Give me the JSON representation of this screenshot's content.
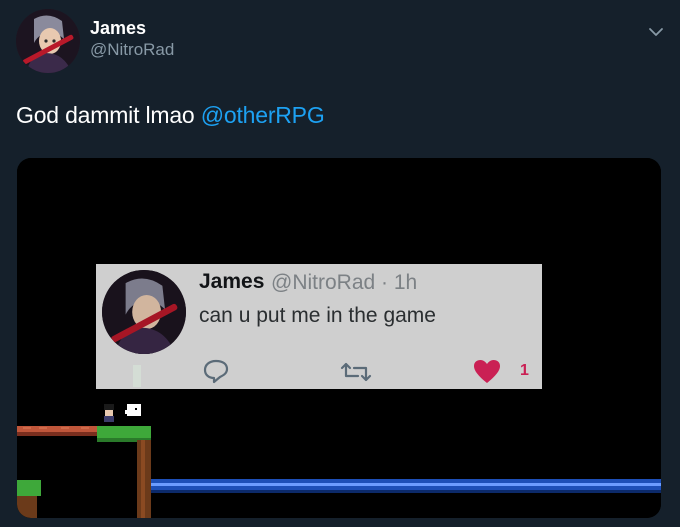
{
  "tweet": {
    "author_name": "James",
    "author_handle": "@NitroRad",
    "text": "God dammit lmao ",
    "mention": "@otherRPG",
    "menu_icon": "chevron-down-icon"
  },
  "media": {
    "description_icon": "game-screenshot",
    "embedded_tweet": {
      "author_name": "James",
      "author_handle": "@NitroRad · 1h",
      "text": "can u put me in the game",
      "reply_icon": "reply-icon",
      "retweet_icon": "retweet-icon",
      "like_icon": "heart-icon",
      "like_count": "1",
      "like_color": "#e0245e"
    }
  },
  "colors": {
    "background": "#15202b",
    "accent": "#1da1f2",
    "secondary_text": "#8899a6"
  }
}
